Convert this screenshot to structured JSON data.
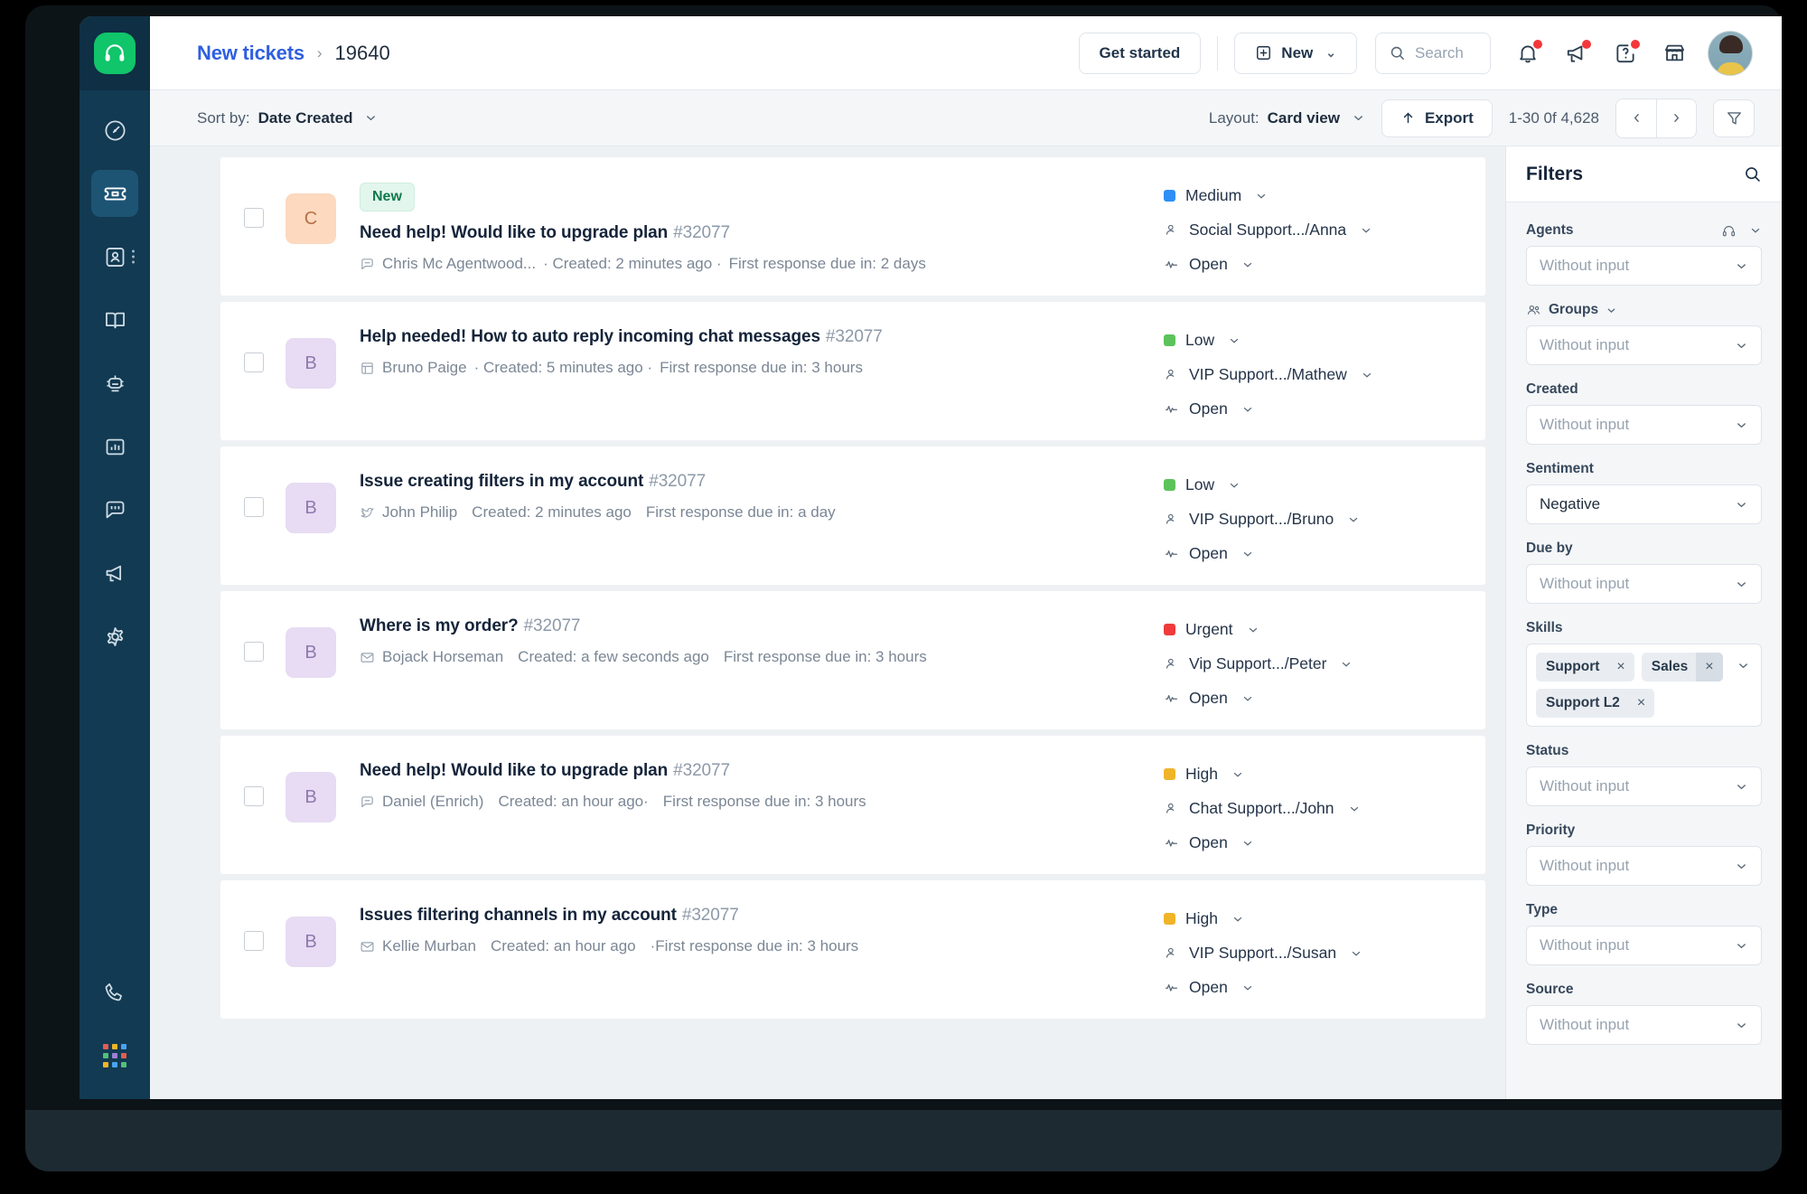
{
  "colors": {
    "rail_bg": "#123a52",
    "logo_green": "#10c56a",
    "accent_link": "#2f5fe0",
    "priority_medium": "#2f8ff5",
    "priority_low": "#5cc35c",
    "priority_high": "#f0b429",
    "priority_urgent": "#ef3b3b",
    "badge_new_bg": "#e3f6ed",
    "badge_new_text": "#0e7a4b"
  },
  "rail": {
    "logo_icon": "headset-icon",
    "items": [
      {
        "icon": "dashboard-icon",
        "name": "sidebar-item-dashboard",
        "active": false
      },
      {
        "icon": "ticket-icon",
        "name": "sidebar-item-tickets",
        "active": true
      },
      {
        "icon": "contacts-icon",
        "name": "sidebar-item-contacts",
        "active": false
      },
      {
        "icon": "knowledge-base-icon",
        "name": "sidebar-item-knowledge-base",
        "active": false
      },
      {
        "icon": "automation-bot-icon",
        "name": "sidebar-item-automations",
        "active": false
      },
      {
        "icon": "analytics-icon",
        "name": "sidebar-item-analytics",
        "active": false
      },
      {
        "icon": "chat-icon",
        "name": "sidebar-item-chat",
        "active": false
      },
      {
        "icon": "megaphone-icon",
        "name": "sidebar-item-campaigns",
        "active": false
      },
      {
        "icon": "gear-icon",
        "name": "sidebar-item-settings",
        "active": false
      }
    ],
    "bottom_items": [
      {
        "icon": "phone-icon",
        "name": "sidebar-item-phone"
      },
      {
        "icon": "apps-grid-icon",
        "name": "sidebar-item-apps"
      }
    ]
  },
  "topbar": {
    "breadcrumb_parent": "New tickets",
    "breadcrumb_separator": "›",
    "breadcrumb_current": "19640",
    "get_started_label": "Get started",
    "new_label": "New",
    "new_caret": "⌄",
    "search_placeholder": "Search",
    "icons": [
      {
        "name": "notifications-bell-icon",
        "badge": true
      },
      {
        "name": "announcements-megaphone-icon",
        "badge": true
      },
      {
        "name": "help-question-icon",
        "badge": true
      },
      {
        "name": "marketplace-store-icon",
        "badge": false
      }
    ],
    "avatar_name": "user-avatar"
  },
  "subbar": {
    "sort_prefix": "Sort by:",
    "sort_value": "Date Created",
    "layout_prefix": "Layout:",
    "layout_value": "Card view",
    "export_label": "Export",
    "export_icon": "upload-arrow-icon",
    "pagination": "1-30 0f 4,628",
    "prev_icon": "chevron-left-icon",
    "next_icon": "chevron-right-icon",
    "filter_icon": "funnel-icon"
  },
  "tickets": [
    {
      "badge": "New",
      "avatar_letter": "C",
      "avatar_bg": "#fcd9bf",
      "avatar_fg": "#b5714a",
      "subject": "Need help! Would like to upgrade plan",
      "ticket_id": "#32077",
      "channel_icon": "chat-bubble-icon",
      "requester": "Chris Mc Agentwood...",
      "created": "· Created: 2 minutes ago ·",
      "due": "First response due in: 2 days",
      "priority": "Medium",
      "priority_color": "#2f8ff5",
      "assignee": "Social Support.../Anna",
      "status": "Open"
    },
    {
      "badge": "",
      "avatar_letter": "B",
      "avatar_bg": "#e7dcf3",
      "avatar_fg": "#8e79ae",
      "subject": "Help needed! How to auto reply incoming chat messages",
      "ticket_id": "#32077",
      "channel_icon": "portal-icon",
      "requester": "Bruno Paige",
      "created": "· Created: 5 minutes ago ·",
      "due": "First response due in: 3 hours",
      "priority": "Low",
      "priority_color": "#5cc35c",
      "assignee": "VIP Support.../Mathew",
      "status": "Open"
    },
    {
      "badge": "",
      "avatar_letter": "B",
      "avatar_bg": "#e7dcf3",
      "avatar_fg": "#8e79ae",
      "subject": "Issue creating filters in my account",
      "ticket_id": "#32077",
      "channel_icon": "twitter-bird-icon",
      "requester": "John Philip",
      "created": "Created: 2 minutes ago",
      "due": "First response due in: a day",
      "priority": "Low",
      "priority_color": "#5cc35c",
      "assignee": "VIP Support.../Bruno",
      "status": "Open"
    },
    {
      "badge": "",
      "avatar_letter": "B",
      "avatar_bg": "#e7dcf3",
      "avatar_fg": "#8e79ae",
      "subject": "Where is my order?",
      "ticket_id": "#32077",
      "channel_icon": "email-icon",
      "requester": "Bojack Horseman",
      "created": "Created: a few seconds ago",
      "due": "First response due in: 3 hours",
      "priority": "Urgent",
      "priority_color": "#ef3b3b",
      "assignee": "Vip Support.../Peter",
      "status": "Open"
    },
    {
      "badge": "",
      "avatar_letter": "B",
      "avatar_bg": "#e7dcf3",
      "avatar_fg": "#8e79ae",
      "subject": "Need help! Would like to upgrade plan",
      "ticket_id": "#32077",
      "channel_icon": "chat-bubble-icon",
      "requester": "Daniel (Enrich)",
      "created": "Created: an hour ago·",
      "due": "First response due in: 3 hours",
      "priority": "High",
      "priority_color": "#f0b429",
      "assignee": "Chat Support.../John",
      "status": "Open"
    },
    {
      "badge": "",
      "avatar_letter": "B",
      "avatar_bg": "#e7dcf3",
      "avatar_fg": "#8e79ae",
      "subject": "Issues filtering channels in my account",
      "ticket_id": "#32077",
      "channel_icon": "email-icon",
      "requester": "Kellie Murban",
      "created": "Created: an hour ago",
      "due": "·First response due in: 3 hours",
      "priority": "High",
      "priority_color": "#f0b429",
      "assignee": "VIP Support.../Susan",
      "status": "Open"
    }
  ],
  "filters": {
    "title": "Filters",
    "search_icon": "search-icon",
    "placeholder": "Without input",
    "groups": [
      {
        "label": "Agents",
        "icon": "headphones-icon",
        "trailing_chevron": true,
        "value": "",
        "type": "select"
      },
      {
        "label": "Groups",
        "icon": "people-icon",
        "label_chevron": true,
        "value": "",
        "type": "select"
      },
      {
        "label": "Created",
        "value": "",
        "type": "select"
      },
      {
        "label": "Sentiment",
        "value": "Negative",
        "type": "select"
      },
      {
        "label": "Due by",
        "value": "",
        "type": "select"
      },
      {
        "label": "Skills",
        "type": "chips",
        "chips": [
          {
            "text": "Support",
            "remove": "×",
            "highlight": false
          },
          {
            "text": "Sales",
            "remove": "×",
            "highlight": true
          },
          {
            "text": "Support L2",
            "remove": "×",
            "highlight": false
          }
        ]
      },
      {
        "label": "Status",
        "value": "",
        "type": "select"
      },
      {
        "label": "Priority",
        "value": "",
        "type": "select"
      },
      {
        "label": "Type",
        "value": "",
        "type": "select"
      },
      {
        "label": "Source",
        "value": "",
        "type": "select"
      }
    ]
  }
}
